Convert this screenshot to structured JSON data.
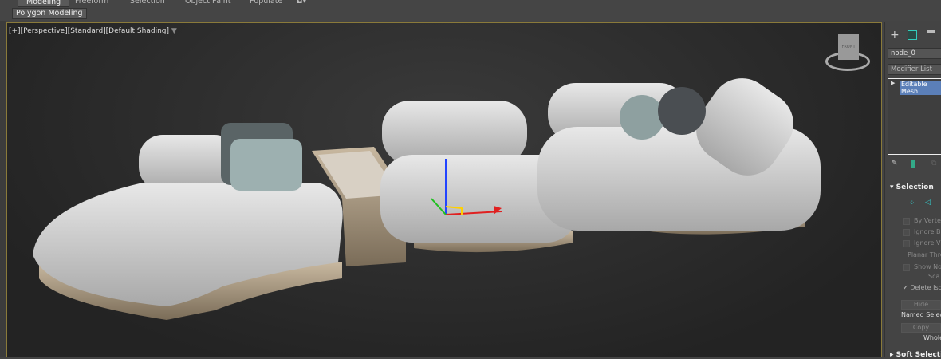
{
  "ribbon": {
    "tabs": [
      "Modeling",
      "Freeform",
      "Selection",
      "Object Paint",
      "Populate"
    ],
    "subtab": "Polygon Modeling"
  },
  "viewport": {
    "label": "[+][Perspective][Standard][Default Shading]",
    "viewcube_face": "FRONT"
  },
  "panel": {
    "object_name": "node_0",
    "modifier_list": "Modifier List",
    "stack_item": "Editable Mesh",
    "selection": {
      "title": "Selection",
      "by_vertex": "By Vertex",
      "ignore_backfacing": "Ignore Ba",
      "ignore_visible": "Ignore Vis",
      "planar_threshold": "Planar Thres",
      "show_normals": "Show Nor",
      "scale": "Sca",
      "delete_isolated": "Delete Iso",
      "hide": "Hide",
      "named_selections": "Named Selecti",
      "copy": "Copy",
      "whole": "Whole"
    },
    "soft_selection": "Soft Selection"
  },
  "colors": {
    "accent": "#5b7fb8",
    "viewport_border": "#8a7a3a"
  }
}
